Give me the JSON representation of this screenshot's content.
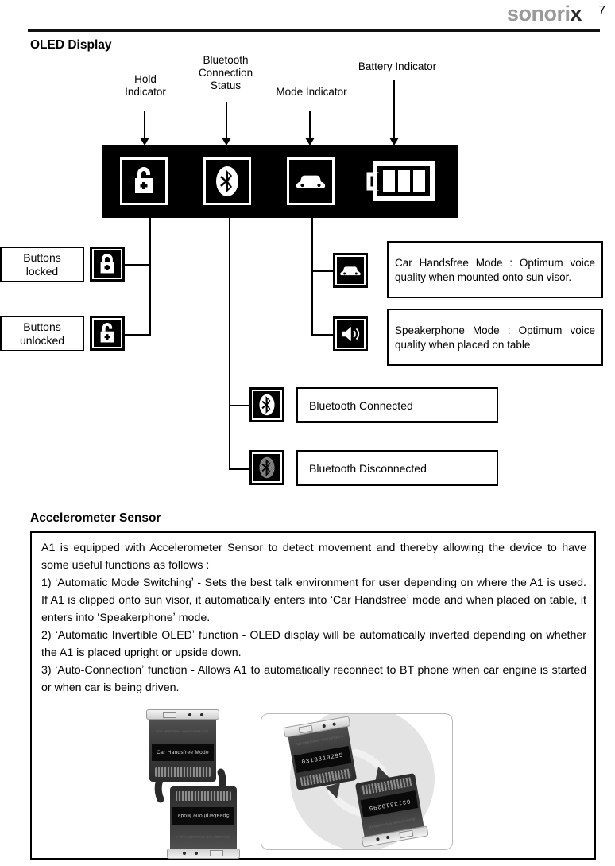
{
  "header": {
    "brand_main": "sonori",
    "brand_x": "x",
    "page_number": "7"
  },
  "sections": {
    "oled_title": "OLED Display",
    "accelerometer_title": "Accelerometer Sensor"
  },
  "callouts": [
    {
      "name": "hold-indicator",
      "label": "Hold\nIndicator"
    },
    {
      "name": "bluetooth-connection-status",
      "label": "Bluetooth\nConnection\nStatus"
    },
    {
      "name": "mode-indicator",
      "label": "Mode Indicator"
    },
    {
      "name": "battery-indicator",
      "label": "Battery Indicator"
    }
  ],
  "callout_text": {
    "hold_line1": "Hold",
    "hold_line2": "Indicator",
    "bt_line1": "Bluetooth",
    "bt_line2": "Connection",
    "bt_line3": "Status",
    "mode": "Mode Indicator",
    "battery": "Battery Indicator"
  },
  "oled_panel": {
    "background_color": "#000000",
    "foreground_color": "#ffffff",
    "icons": [
      {
        "name": "padlock-unlocked-icon",
        "state": "unlocked"
      },
      {
        "name": "bluetooth-icon",
        "state": "connected"
      },
      {
        "name": "car-icon",
        "state": "car-handsfree"
      },
      {
        "name": "battery-icon",
        "bars": 3
      }
    ]
  },
  "legend": {
    "hold": [
      {
        "icon": "padlock-locked-icon",
        "line1": "Buttons",
        "line2": "locked"
      },
      {
        "icon": "padlock-unlocked-icon",
        "line1": "Buttons",
        "line2": "unlocked"
      }
    ],
    "mode": [
      {
        "icon": "car-icon",
        "text": "Car Handsfree Mode : Optimum voice quality when mounted onto sun visor."
      },
      {
        "icon": "speaker-icon",
        "text": "Speakerphone Mode : Optimum voice quality when placed on table"
      }
    ],
    "bluetooth": [
      {
        "icon": "bluetooth-connected-icon",
        "text": "Bluetooth Connected"
      },
      {
        "icon": "bluetooth-disconnected-icon",
        "text": "Bluetooth Disconnected"
      }
    ]
  },
  "accelerometer": {
    "paragraphs": [
      "A1 is equipped with Accelerometer Sensor to detect movement and thereby allowing the device to have some useful functions as follows :",
      "1) ʻAutomatic Mode Switchingʼ - Sets the best talk environment for user depending on where the A1 is used. If A1 is clipped onto sun visor, it automatically enters into ʻCar Handsfreeʼ mode and when placed on table, it enters into ʻSpeakerphoneʼ mode.",
      "2) ʻAutomatic Invertible OLEDʼ function - OLED display will be automatically inverted depending on whether the A1 is placed upright or upside down.",
      "3) ʻAuto-Connectionʼ function - Allows A1 to automatically reconnect to BT phone when car engine is started or when car is being driven."
    ]
  },
  "figures": {
    "mode_switch": {
      "name": "mode-switching-figure",
      "device_top_screen": "Car Handsfree Mode",
      "device_top_faint": "FOR PERSONAL HANDSFREE USE ONLY",
      "device_bottom_screen": "Speakerphone Mode",
      "device_bottom_faint": "DESIGNED FOR SPEAKERPHONE CONVERSATION"
    },
    "invertible_oled": {
      "name": "invertible-oled-figure",
      "device_top_screen": "0313810295",
      "device_top_faint": "FOR PERSONAL HANDSFREE USE ONLY",
      "device_bottom_screen": "0313810295",
      "device_bottom_faint": "DESIGNED FOR SPEAKERPHONE USE"
    }
  }
}
